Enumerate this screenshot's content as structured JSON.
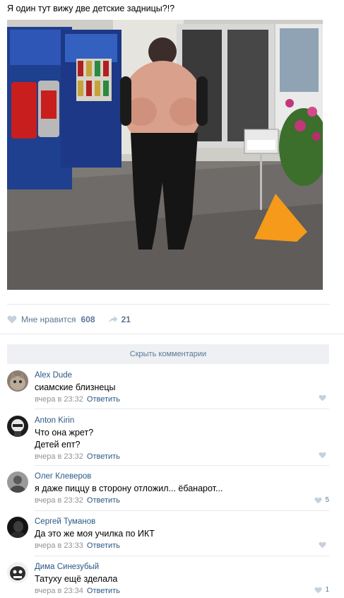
{
  "post": {
    "text": "Я один тут вижу две детские задницы?!?"
  },
  "photo": {
    "description_icon": "image-icon"
  },
  "actions": {
    "like_label": "Мне нравится",
    "like_count": "608",
    "share_count": "21"
  },
  "hide_comments_label": "Скрыть комментарии",
  "comments": [
    {
      "author": "Alex Dude",
      "lines": [
        "сиамские близнецы"
      ],
      "time": "вчера в 23:32",
      "reply": "Ответить",
      "likes": ""
    },
    {
      "author": "Anton Kirin",
      "lines": [
        "Что она жрет?",
        "Детей епт?"
      ],
      "time": "вчера в 23:32",
      "reply": "Ответить",
      "likes": ""
    },
    {
      "author": "Олег Клеверов",
      "lines": [
        "я даже пиццу в сторону отложил... ёбанарот..."
      ],
      "time": "вчера в 23:32",
      "reply": "Ответить",
      "likes": "5"
    },
    {
      "author": "Сергей Туманов",
      "lines": [
        "Да это же моя училка по ИКТ"
      ],
      "time": "вчера в 23:33",
      "reply": "Ответить",
      "likes": ""
    },
    {
      "author": "Дима Синезубый",
      "lines": [
        "Татуху ещё зделала"
      ],
      "time": "вчера в 23:34",
      "reply": "Ответить",
      "likes": "1"
    }
  ],
  "colors": {
    "link": "#2a5885",
    "action": "#5b7897",
    "meta": "#939393",
    "heart": "#c5d0db",
    "hide_bg": "#eef0f3"
  }
}
